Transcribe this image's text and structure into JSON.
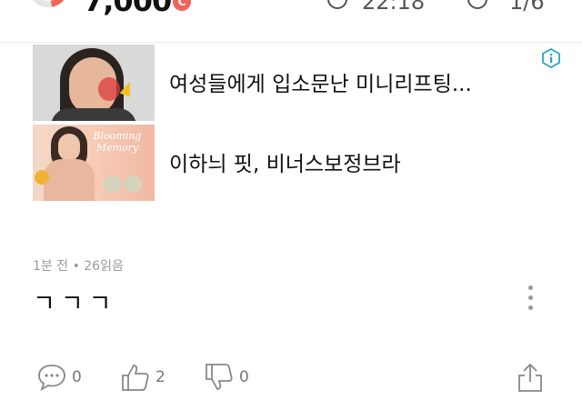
{
  "status_bar": {
    "points": "7,000",
    "coin_label": "C",
    "time": "22:18",
    "counter": "1/6"
  },
  "ads": [
    {
      "title": "여성들에게 입소문난 미니리프팅..."
    },
    {
      "title": "이하늬 핏, 비너스보정브라",
      "brand_text": "Blooming Memory"
    }
  ],
  "post": {
    "meta": "1분 전 • 26읽음",
    "body": "ㄱㄱㄱ"
  },
  "actions": {
    "comments": "0",
    "likes": "2",
    "dislikes": "0"
  },
  "colors": {
    "accent": "#f0655a",
    "muted": "#9a9a9a",
    "ad_badge": "#2aa5c0"
  },
  "icons": {
    "ad": "ad-info-icon",
    "comment": "comment-icon",
    "like": "thumbs-up-icon",
    "dislike": "thumbs-down-icon",
    "share": "share-icon",
    "more": "more-vertical-icon",
    "time": "clock-icon",
    "counter": "reward-icon"
  }
}
